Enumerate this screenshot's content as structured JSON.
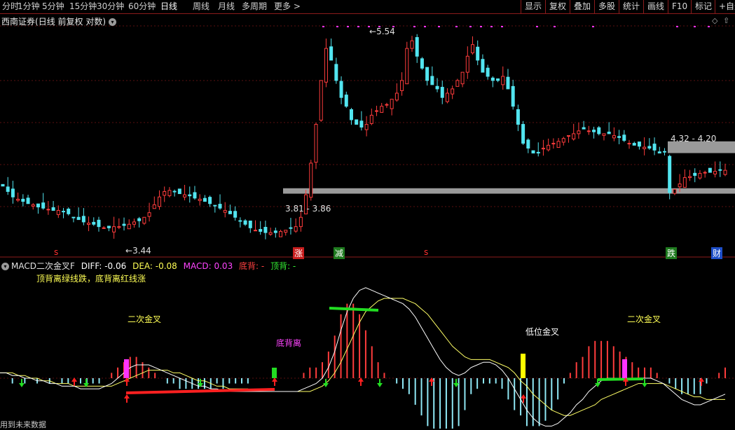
{
  "toolbar": {
    "periods": [
      "分时",
      "1分钟",
      "5分钟",
      "15分钟",
      "30分钟",
      "60分钟",
      "日线",
      "周线",
      "月线",
      "多周期",
      "更多 >"
    ],
    "active_period": "日线",
    "right_buttons": [
      "显示",
      "复权",
      "叠加",
      "多股",
      "统计",
      "画线",
      "F10",
      "标记",
      "+自选"
    ]
  },
  "title": {
    "broker": "西南证券",
    "mode": "(日线 前复权 对数)",
    "expand_icon": "chevron-down-icon",
    "diamond_icon": "diamond-icon",
    "arrow_icon": "arrow-up-icon"
  },
  "price_labels": {
    "high": "5.54",
    "low": "3.44",
    "support_band": "3.81 - 3.86",
    "resistance_band": "4.32 - 4.20"
  },
  "event_markers": [
    {
      "text": "s",
      "color": "#ff3030",
      "bg": ""
    },
    {
      "text": "涨",
      "color": "#ffffff",
      "bg": "#c81e1e"
    },
    {
      "text": "减",
      "color": "#ffffff",
      "bg": "#1e7a1e"
    },
    {
      "text": "s",
      "color": "#ff3030",
      "bg": ""
    },
    {
      "text": "跌",
      "color": "#ffffff",
      "bg": "#1e7a1e"
    },
    {
      "text": "财",
      "color": "#ffffff",
      "bg": "#1e4fc8"
    }
  ],
  "indicator": {
    "name": "MACD二次金叉F",
    "diff_label": "DIFF: -0.06",
    "dea_label": "DEA: -0.08",
    "macd_label": "MACD: 0.03",
    "bottom_div_label": "底背: -",
    "top_div_label": "顶背: -",
    "note": "顶背离绿线跌，底背离红线涨",
    "annotations": [
      "二次金叉",
      "底背离",
      "低位金叉",
      "二次金叉"
    ]
  },
  "footer": "用到未来数据",
  "colors": {
    "up": "#ff3c3c",
    "down": "#52e5f0",
    "band": "#9a9a9a",
    "magenta": "#ff33ff",
    "diff": "#ffffff",
    "dea": "#ffff66",
    "signal_green": "#22dd22",
    "signal_red": "#ff2020",
    "highlight_yellow": "#ffff00"
  },
  "chart_data": {
    "type": "candlestick",
    "price_axis": "log",
    "close": [
      3.88,
      3.83,
      3.78,
      3.76,
      3.74,
      3.72,
      3.71,
      3.69,
      3.68,
      3.67,
      3.66,
      3.66,
      3.65,
      3.63,
      3.6,
      3.58,
      3.56,
      3.55,
      3.54,
      3.52,
      3.51,
      3.51,
      3.52,
      3.52,
      3.53,
      3.54,
      3.56,
      3.57,
      3.6,
      3.64,
      3.71,
      3.78,
      3.83,
      3.84,
      3.83,
      3.81,
      3.8,
      3.79,
      3.77,
      3.76,
      3.74,
      3.72,
      3.7,
      3.68,
      3.66,
      3.63,
      3.6,
      3.57,
      3.54,
      3.51,
      3.49,
      3.48,
      3.47,
      3.47,
      3.47,
      3.48,
      3.49,
      3.51,
      3.52,
      3.6,
      3.8,
      4.1,
      4.5,
      5.0,
      5.4,
      5.25,
      5.0,
      4.8,
      4.7,
      4.55,
      4.5,
      4.47,
      4.5,
      4.6,
      4.65,
      4.7,
      4.72,
      4.78,
      4.85,
      5.0,
      5.4,
      5.5,
      5.3,
      5.15,
      5.0,
      4.95,
      4.9,
      4.8,
      4.85,
      4.9,
      5.0,
      5.1,
      5.3,
      5.45,
      5.25,
      5.1,
      5.05,
      5.0,
      5.0,
      5.05,
      4.9,
      4.7,
      4.5,
      4.3,
      4.25,
      4.2,
      4.2,
      4.25,
      4.28,
      4.3,
      4.32,
      4.35,
      4.38,
      4.4,
      4.43,
      4.45,
      4.43,
      4.42,
      4.4,
      4.4,
      4.4,
      4.38,
      4.36,
      4.33,
      4.3,
      4.28,
      4.27,
      4.26,
      4.25,
      4.23,
      4.2,
      4.21,
      3.82,
      3.85,
      3.9,
      3.96,
      3.97,
      3.98,
      4.0,
      4.01,
      4.01,
      4.02,
      4.03,
      4.03
    ],
    "y_range_log": [
      3.3,
      5.7
    ],
    "macd_diff": [
      0.02,
      0.02,
      0.01,
      0.01,
      0.0,
      0.0,
      -0.01,
      -0.01,
      -0.02,
      -0.02,
      -0.03,
      -0.03,
      -0.03,
      -0.04,
      -0.04,
      -0.04,
      -0.04,
      -0.03,
      -0.02,
      0.0,
      0.02,
      0.04,
      0.05,
      0.05,
      0.05,
      0.04,
      0.03,
      0.02,
      0.01,
      0.0,
      -0.01,
      -0.02,
      -0.03,
      -0.03,
      -0.04,
      -0.04,
      -0.05,
      -0.05,
      -0.05,
      -0.05,
      -0.05,
      -0.05,
      -0.05,
      -0.05,
      -0.05,
      -0.05,
      -0.05,
      -0.05,
      -0.05,
      -0.04,
      -0.03,
      -0.02,
      0.0,
      0.04,
      0.1,
      0.18,
      0.25,
      0.3,
      0.33,
      0.34,
      0.33,
      0.32,
      0.31,
      0.3,
      0.29,
      0.28,
      0.26,
      0.23,
      0.19,
      0.15,
      0.11,
      0.07,
      0.04,
      0.02,
      0.01,
      0.02,
      0.04,
      0.05,
      0.06,
      0.06,
      0.05,
      0.03,
      0.0,
      -0.04,
      -0.08,
      -0.12,
      -0.15,
      -0.17,
      -0.18,
      -0.18,
      -0.17,
      -0.15,
      -0.13,
      -0.1,
      -0.08,
      -0.05,
      -0.03,
      -0.01,
      0.0,
      0.0,
      0.0,
      0.0,
      0.0,
      0.0,
      0.0,
      0.0,
      -0.01,
      -0.02,
      -0.04,
      -0.06,
      -0.08,
      -0.09,
      -0.1,
      -0.1,
      -0.09,
      -0.08,
      -0.07,
      -0.06
    ],
    "macd_dea": [
      0.02,
      0.02,
      0.02,
      0.01,
      0.01,
      0.0,
      0.0,
      -0.01,
      -0.01,
      -0.02,
      -0.02,
      -0.02,
      -0.03,
      -0.03,
      -0.03,
      -0.03,
      -0.03,
      -0.03,
      -0.03,
      -0.02,
      -0.01,
      0.0,
      0.01,
      0.02,
      0.03,
      0.03,
      0.03,
      0.03,
      0.02,
      0.02,
      0.01,
      0.0,
      -0.01,
      -0.01,
      -0.02,
      -0.03,
      -0.03,
      -0.04,
      -0.04,
      -0.04,
      -0.04,
      -0.05,
      -0.05,
      -0.05,
      -0.05,
      -0.05,
      -0.05,
      -0.05,
      -0.05,
      -0.05,
      -0.05,
      -0.04,
      -0.03,
      -0.01,
      0.02,
      0.06,
      0.11,
      0.16,
      0.21,
      0.25,
      0.27,
      0.29,
      0.3,
      0.3,
      0.3,
      0.3,
      0.29,
      0.28,
      0.26,
      0.24,
      0.21,
      0.18,
      0.15,
      0.12,
      0.1,
      0.08,
      0.07,
      0.07,
      0.07,
      0.07,
      0.06,
      0.05,
      0.04,
      0.02,
      -0.01,
      -0.03,
      -0.06,
      -0.08,
      -0.1,
      -0.12,
      -0.13,
      -0.14,
      -0.14,
      -0.13,
      -0.12,
      -0.11,
      -0.1,
      -0.08,
      -0.07,
      -0.06,
      -0.05,
      -0.04,
      -0.03,
      -0.02,
      -0.02,
      -0.02,
      -0.02,
      -0.02,
      -0.03,
      -0.04,
      -0.05,
      -0.06,
      -0.07,
      -0.07,
      -0.08,
      -0.08,
      -0.08,
      -0.08
    ]
  }
}
